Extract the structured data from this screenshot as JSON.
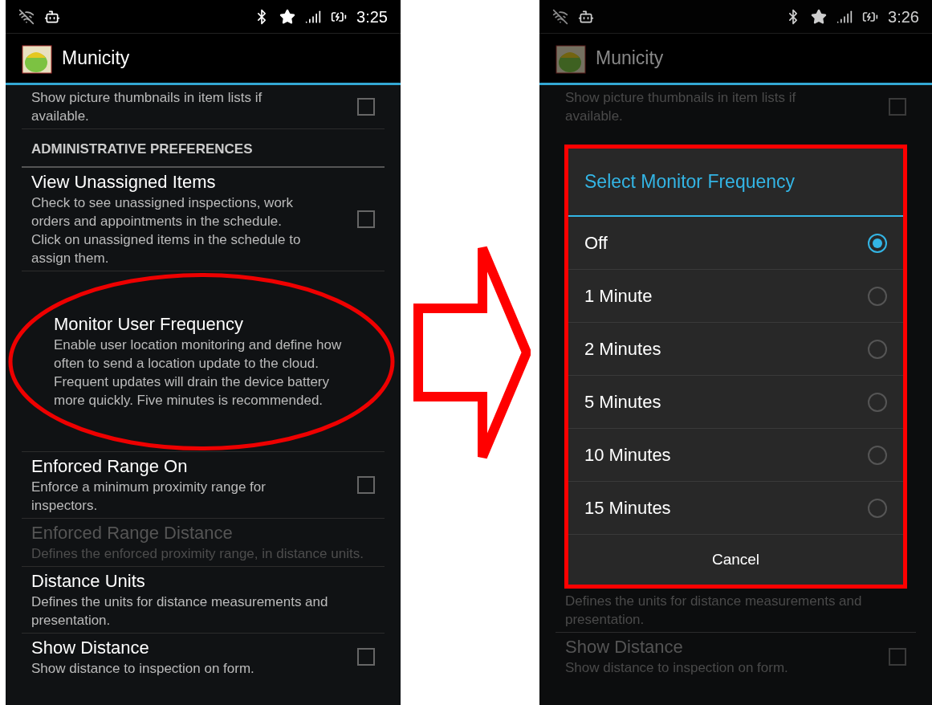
{
  "left_screen": {
    "status_bar": {
      "time": "3:25"
    },
    "app_bar": {
      "title": "Municity"
    },
    "items": [
      {
        "kind": "checkbox_pref",
        "description": "Show picture thumbnails in item lists if available.",
        "checked": false,
        "disabled": false
      },
      {
        "kind": "header",
        "title": "ADMINISTRATIVE PREFERENCES"
      },
      {
        "kind": "checkbox_pref",
        "title": "View Unassigned Items",
        "description": "Check to see unassigned inspections, work orders and appointments in the schedule. Click on unassigned items in the schedule to assign them.",
        "checked": false,
        "disabled": false
      },
      {
        "kind": "pref",
        "title": "Monitor User Frequency",
        "description": "Enable user location monitoring and define how often to send a location update to the cloud. Frequent updates will drain the device battery more quickly. Five minutes is recommended.",
        "disabled": false,
        "highlighted": true
      },
      {
        "kind": "checkbox_pref",
        "title": "Enforced Range On",
        "description": "Enforce a minimum proximity range for inspectors.",
        "checked": false,
        "disabled": false
      },
      {
        "kind": "pref",
        "title": "Enforced Range Distance",
        "description": "Defines the enforced proximity range, in distance units.",
        "disabled": true
      },
      {
        "kind": "pref",
        "title": "Distance Units",
        "description": "Defines the units for distance measurements and presentation.",
        "disabled": false
      },
      {
        "kind": "checkbox_pref",
        "title": "Show Distance",
        "description": "Show distance to inspection on form.",
        "checked": false,
        "disabled": false
      }
    ]
  },
  "right_screen": {
    "status_bar": {
      "time": "3:26"
    },
    "app_bar": {
      "title": "Municity"
    },
    "items_above": [
      {
        "kind": "checkbox_pref",
        "description": "Show picture thumbnails in item lists if available.",
        "checked": false
      }
    ],
    "dialog": {
      "title": "Select Monitor Frequency",
      "options": [
        {
          "label": "Off",
          "selected": true
        },
        {
          "label": "1 Minute",
          "selected": false
        },
        {
          "label": "2 Minutes",
          "selected": false
        },
        {
          "label": "5 Minutes",
          "selected": false
        },
        {
          "label": "10 Minutes",
          "selected": false
        },
        {
          "label": "15 Minutes",
          "selected": false
        }
      ],
      "cancel": "Cancel"
    },
    "items_below": [
      {
        "kind": "pref",
        "description": "Defines the units for distance measurements and presentation."
      },
      {
        "kind": "checkbox_pref",
        "title": "Show Distance",
        "description": "Show distance to inspection on form.",
        "checked": false
      }
    ]
  }
}
